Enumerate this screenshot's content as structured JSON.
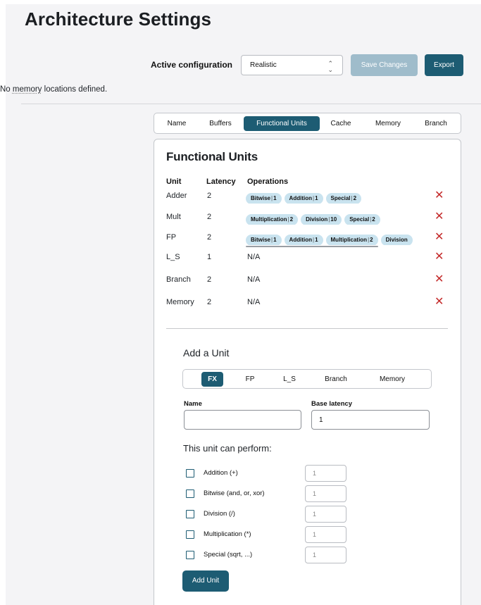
{
  "page": {
    "title": "Architecture Settings"
  },
  "config": {
    "label": "Active configuration",
    "selected": "Realistic",
    "save_label": "Save Changes",
    "export_label": "Export"
  },
  "notice": {
    "prefix": "No ",
    "link": "memory",
    "suffix": " locations defined."
  },
  "tabs": [
    {
      "label": "Name",
      "active": false
    },
    {
      "label": "Buffers",
      "active": false
    },
    {
      "label": "Functional Units",
      "active": true
    },
    {
      "label": "Cache",
      "active": false
    },
    {
      "label": "Memory",
      "active": false
    },
    {
      "label": "Branch",
      "active": false
    }
  ],
  "functional_units": {
    "title": "Functional Units",
    "headers": {
      "unit": "Unit",
      "latency": "Latency",
      "operations": "Operations"
    },
    "na": "N/A",
    "delete_glyph": "✕",
    "rows": [
      {
        "unit": "Adder",
        "latency": "2",
        "ops": [
          {
            "name": "Bitwise",
            "lat": "1"
          },
          {
            "name": "Addition",
            "lat": "1"
          },
          {
            "name": "Special",
            "lat": "2"
          }
        ],
        "ops_text": ""
      },
      {
        "unit": "Mult",
        "latency": "2",
        "ops": [
          {
            "name": "Multiplication",
            "lat": "2"
          },
          {
            "name": "Division",
            "lat": "10"
          },
          {
            "name": "Special",
            "lat": "2"
          }
        ],
        "ops_text": ""
      },
      {
        "unit": "FP",
        "latency": "2",
        "ops": [
          {
            "name": "Bitwise",
            "lat": "1"
          },
          {
            "name": "Addition",
            "lat": "1"
          },
          {
            "name": "Multiplication",
            "lat": "2"
          },
          {
            "name": "Division",
            "lat": ""
          }
        ],
        "ops_text": ""
      },
      {
        "unit": "L_S",
        "latency": "1",
        "ops": [],
        "ops_text": "N/A"
      },
      {
        "unit": "Branch",
        "latency": "2",
        "ops": [],
        "ops_text": "N/A"
      },
      {
        "unit": "Memory",
        "latency": "2",
        "ops": [],
        "ops_text": "N/A"
      }
    ]
  },
  "add_unit": {
    "title": "Add a Unit",
    "types": [
      {
        "label": "FX",
        "active": true
      },
      {
        "label": "FP",
        "active": false
      },
      {
        "label": "L_S",
        "active": false
      },
      {
        "label": "Branch",
        "active": false
      },
      {
        "label": "Memory",
        "active": false
      }
    ],
    "name_label": "Name",
    "name_value": "",
    "latency_label": "Base latency",
    "latency_value": "1",
    "perform_label": "This unit can perform:",
    "operations": [
      {
        "label": "Addition (+)",
        "placeholder": "1",
        "checked": false
      },
      {
        "label": "Bitwise (and, or, xor)",
        "placeholder": "1",
        "checked": false
      },
      {
        "label": "Division (/)",
        "placeholder": "1",
        "checked": false
      },
      {
        "label": "Multiplication (*)",
        "placeholder": "1",
        "checked": false
      },
      {
        "label": "Special (sqrt, ...)",
        "placeholder": "1",
        "checked": false
      }
    ],
    "submit_label": "Add Unit"
  },
  "colors": {
    "accent": "#1d5c73",
    "accent_disabled": "#9fbccb",
    "pill": "#c9e3ef",
    "danger": "#c42b2b"
  }
}
